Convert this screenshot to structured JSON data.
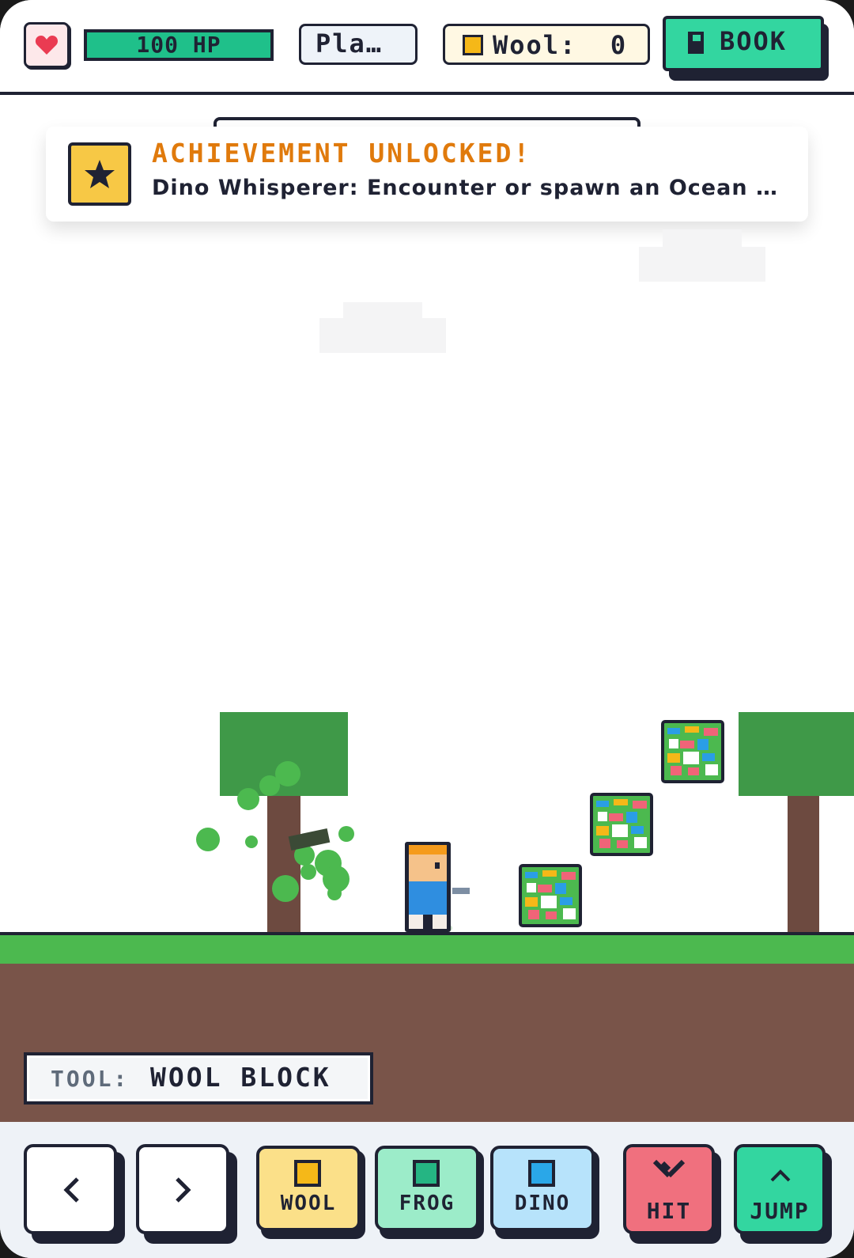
{
  "hud": {
    "health_icon": "heart-icon",
    "hp_label": "100 HP",
    "player_label": "Pla…",
    "wool_label": "Wool:",
    "wool_count": "0",
    "book_label": "BOOK",
    "book_icon": "book-icon"
  },
  "achievement": {
    "icon": "star-icon",
    "title": "ACHIEVEMENT UNLOCKED!",
    "description": "Dino Whisperer: Encounter or spawn an Ocean …"
  },
  "tool": {
    "key": "TOOL:",
    "value": "WOOL BLOCK"
  },
  "controls": {
    "left_icon": "chevron-left-icon",
    "right_icon": "chevron-right-icon",
    "wool_label": "WOOL",
    "frog_label": "FROG",
    "dino_label": "DINO",
    "hit_label": "HIT",
    "jump_label": "JUMP"
  },
  "colors": {
    "hp_green": "#1fc08a",
    "book_green": "#33d6a0",
    "achievement_orange": "#e07a0c",
    "wool_yellow": "#f5b818",
    "frog_green": "#25b583",
    "dino_blue": "#2aa7e8",
    "hit_red": "#f0707e",
    "grass": "#4cb94f",
    "dirt": "#795449"
  }
}
